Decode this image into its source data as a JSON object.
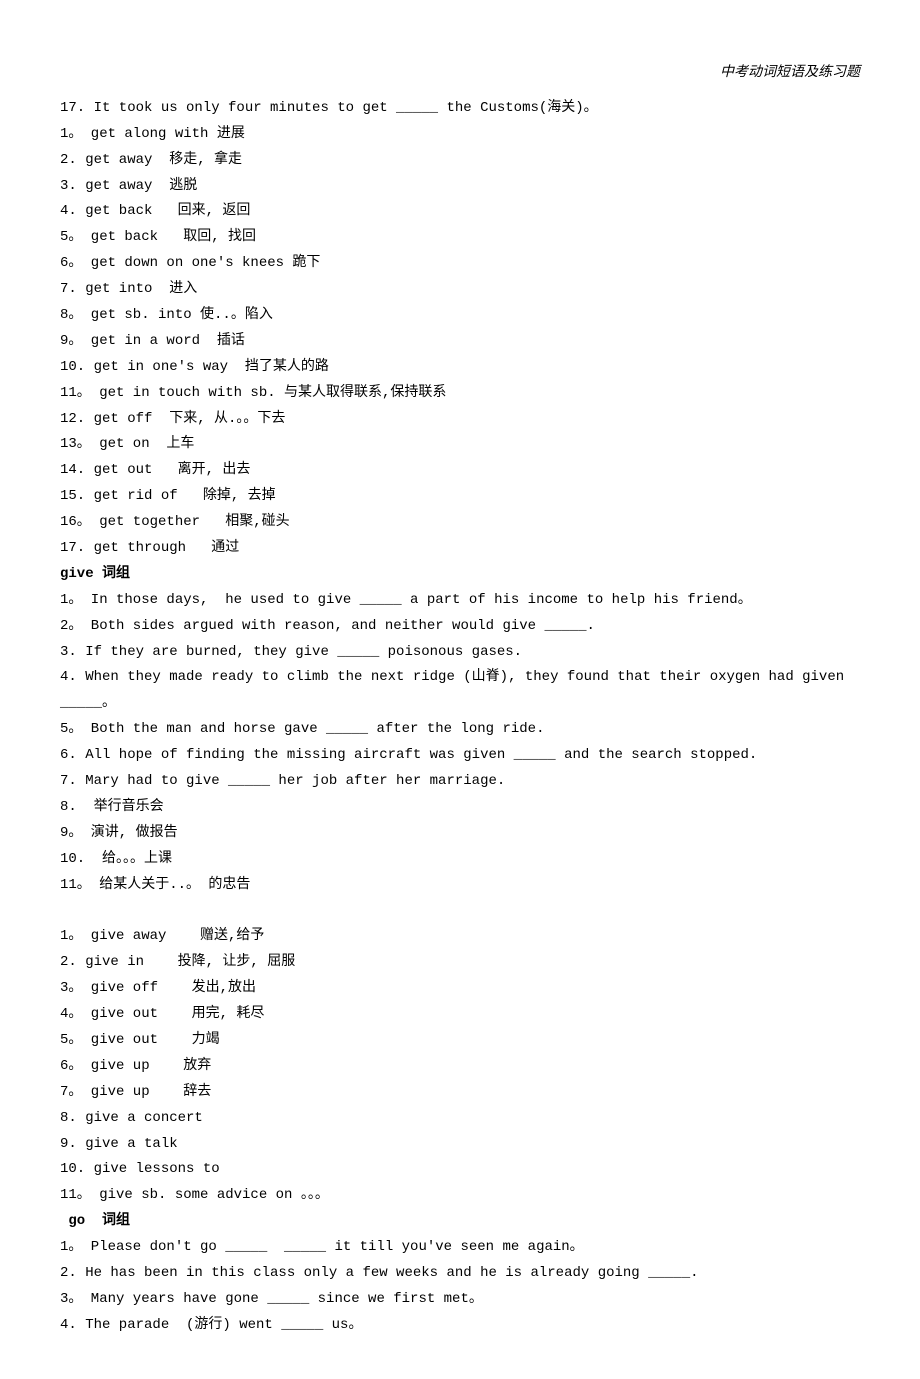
{
  "header": "中考动词短语及练习题",
  "lines": [
    {
      "text": "17. It took us only four minutes to get _____ the Customs(海关)。",
      "bold": false
    },
    {
      "text": "1。 get along with 进展",
      "bold": false
    },
    {
      "text": "2. get away  移走, 拿走",
      "bold": false
    },
    {
      "text": "3. get away  逃脱",
      "bold": false
    },
    {
      "text": "4. get back   回来, 返回",
      "bold": false
    },
    {
      "text": "5。 get back   取回, 找回",
      "bold": false
    },
    {
      "text": "6。 get down on one's knees 跪下",
      "bold": false
    },
    {
      "text": "7. get into  进入",
      "bold": false
    },
    {
      "text": "8。 get sb. into 使..。陷入",
      "bold": false
    },
    {
      "text": "9。 get in a word  插话",
      "bold": false
    },
    {
      "text": "10. get in one's way  挡了某人的路",
      "bold": false
    },
    {
      "text": "11。 get in touch with sb. 与某人取得联系,保持联系",
      "bold": false
    },
    {
      "text": "12. get off  下来, 从.。。下去",
      "bold": false
    },
    {
      "text": "13。 get on  上车",
      "bold": false
    },
    {
      "text": "14. get out   离开, 出去",
      "bold": false
    },
    {
      "text": "15. get rid of   除掉, 去掉",
      "bold": false
    },
    {
      "text": "16。 get together   相聚,碰头",
      "bold": false
    },
    {
      "text": "17. get through   通过",
      "bold": false
    },
    {
      "text": "give 词组",
      "bold": true
    },
    {
      "text": "1。 In those days,  he used to give _____ a part of his income to help his friend。",
      "bold": false
    },
    {
      "text": "2。 Both sides argued with reason, and neither would give _____.",
      "bold": false
    },
    {
      "text": "3. If they are burned, they give _____ poisonous gases.",
      "bold": false
    },
    {
      "text": "4. When they made ready to climb the next ridge (山脊), they found that their oxygen had given _____。",
      "bold": false
    },
    {
      "text": "5。 Both the man and horse gave _____ after the long ride.",
      "bold": false
    },
    {
      "text": "6. All hope of finding the missing aircraft was given _____ and the search stopped.",
      "bold": false
    },
    {
      "text": "7. Mary had to give _____ her job after her marriage.",
      "bold": false
    },
    {
      "text": "8.  举行音乐会",
      "bold": false
    },
    {
      "text": "9。 演讲, 做报告",
      "bold": false
    },
    {
      "text": "10.  给。。。上课",
      "bold": false
    },
    {
      "text": "11。 给某人关于..。 的忠告",
      "bold": false
    },
    {
      "text": " ",
      "bold": false
    },
    {
      "text": "1。 give away    赠送,给予",
      "bold": false
    },
    {
      "text": "2. give in    投降, 让步, 屈服",
      "bold": false
    },
    {
      "text": "3。 give off    发出,放出",
      "bold": false
    },
    {
      "text": "4。 give out    用完, 耗尽",
      "bold": false
    },
    {
      "text": "5。 give out    力竭",
      "bold": false
    },
    {
      "text": "6。 give up    放弃",
      "bold": false
    },
    {
      "text": "7。 give up    辞去",
      "bold": false
    },
    {
      "text": "8. give a concert",
      "bold": false
    },
    {
      "text": "9. give a talk",
      "bold": false
    },
    {
      "text": "10. give lessons to",
      "bold": false
    },
    {
      "text": "11。 give sb. some advice on 。。。",
      "bold": false
    },
    {
      "text": " go  词组",
      "bold": true
    },
    {
      "text": "1。 Please don't go _____  _____ it till you've seen me again。",
      "bold": false
    },
    {
      "text": "2. He has been in this class only a few weeks and he is already going _____.",
      "bold": false
    },
    {
      "text": "3。 Many years have gone _____ since we first met。",
      "bold": false
    },
    {
      "text": "4. The parade  (游行) went _____ us。",
      "bold": false
    }
  ]
}
